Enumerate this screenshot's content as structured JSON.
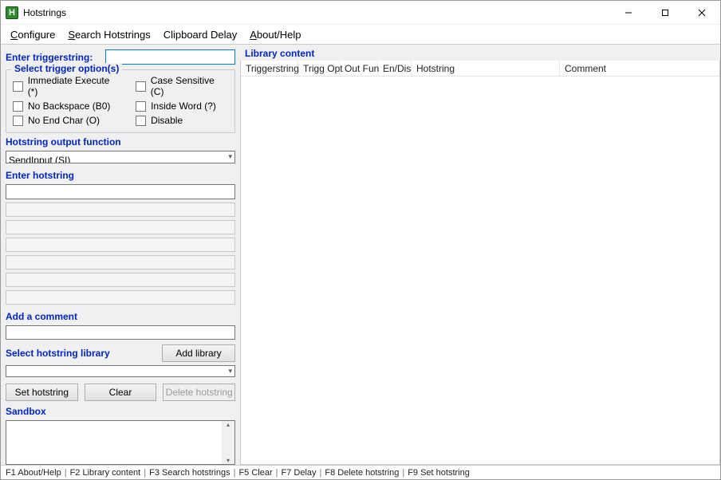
{
  "window": {
    "title": "Hotstrings"
  },
  "menu": {
    "configure": "Configure",
    "search": "Search Hotstrings",
    "clipboard": "Clipboard Delay",
    "about": "About/Help"
  },
  "left": {
    "enter_trigger_label": "Enter triggerstring:",
    "trigger_value": "",
    "options_legend": "Select trigger option(s)",
    "opt_immediate": "Immediate Execute (*)",
    "opt_nobackspace": "No Backspace (B0)",
    "opt_noendchar": "No End Char (O)",
    "opt_casesensitive": "Case Sensitive (C)",
    "opt_insideword": "Inside Word (?)",
    "opt_disable": "Disable",
    "output_func_label": "Hotstring output function",
    "output_func_value": "SendInput (SI)",
    "enter_hotstring_label": "Enter hotstring",
    "hotstring_value": "",
    "comment_label": "Add a comment",
    "comment_value": "",
    "library_label": "Select hotstring library",
    "add_library_btn": "Add library",
    "library_value": "",
    "set_btn": "Set hotstring",
    "clear_btn": "Clear",
    "delete_btn": "Delete hotstring",
    "sandbox_label": "Sandbox"
  },
  "right": {
    "header": "Library content",
    "cols": {
      "trigger": "Triggerstring",
      "trigopt": "Trigg Opt",
      "outfun": "Out Fun",
      "endis": "En/Dis",
      "hotstring": "Hotstring",
      "comment": "Comment"
    }
  },
  "status": {
    "f1": "F1 About/Help",
    "f2": "F2 Library content",
    "f3": "F3 Search hotstrings",
    "f5": "F5 Clear",
    "f7": "F7 Delay",
    "f8": "F8 Delete hotstring",
    "f9": "F9 Set hotstring"
  }
}
